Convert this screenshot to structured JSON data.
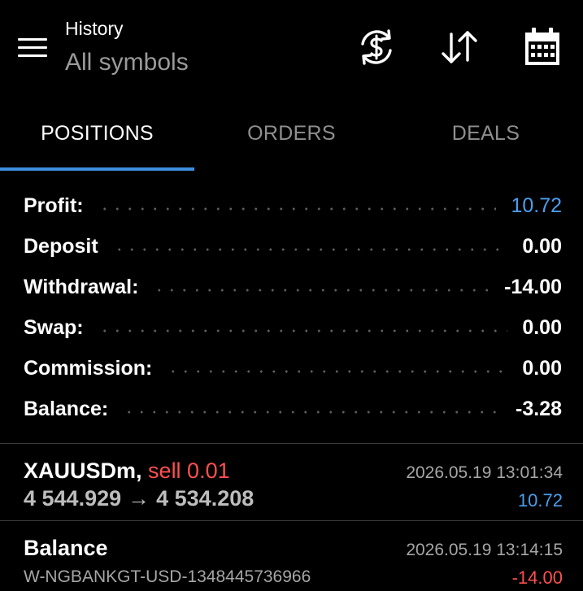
{
  "header": {
    "title": "History",
    "subtitle": "All symbols",
    "icons": [
      "menu-icon",
      "currency-exchange-icon",
      "sort-icon",
      "calendar-icon"
    ]
  },
  "tabs": [
    {
      "label": "POSITIONS",
      "active": true
    },
    {
      "label": "ORDERS",
      "active": false
    },
    {
      "label": "DEALS",
      "active": false
    }
  ],
  "summary": [
    {
      "label": "Profit:",
      "value": "10.72"
    },
    {
      "label": "Deposit",
      "value": "0.00"
    },
    {
      "label": "Withdrawal:",
      "value": "-14.00"
    },
    {
      "label": "Swap:",
      "value": "0.00"
    },
    {
      "label": "Commission:",
      "value": "0.00"
    },
    {
      "label": "Balance:",
      "value": "-3.28"
    }
  ],
  "positions": [
    {
      "symbol": "XAUUSDm,",
      "side": "sell 0.01",
      "open_price": "4 544.929",
      "arrow": "→",
      "close_price": "4 534.208",
      "time": "2026.05.19 13:01:34",
      "amount": "10.72"
    }
  ],
  "operations": [
    {
      "label": "Balance",
      "comment": "W-NGBANKGT-USD-1348445736966",
      "time": "2026.05.19 13:14:15",
      "amount": "-14.00"
    }
  ],
  "colors": {
    "accent": "#3d8fe0",
    "profit": "#4a9ff0",
    "loss": "#ff4f4f",
    "background": "#000000"
  }
}
